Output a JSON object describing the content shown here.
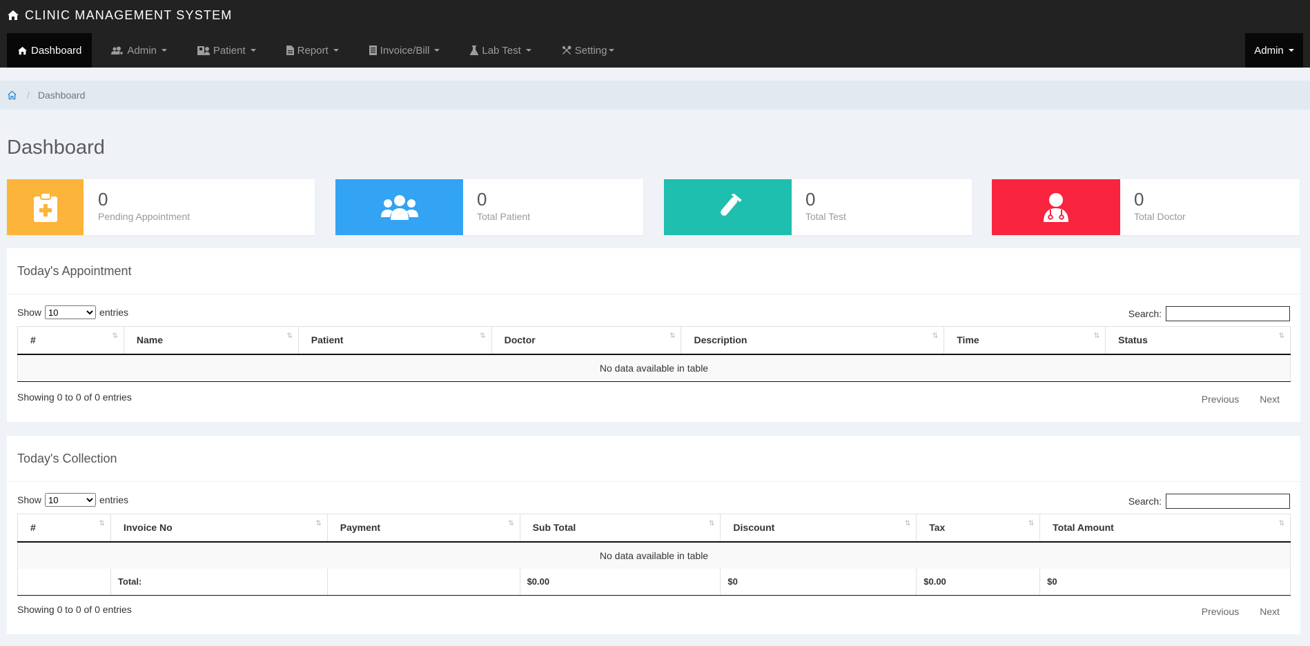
{
  "app": {
    "title": "CLINIC MANAGEMENT SYSTEM"
  },
  "nav": {
    "items": [
      {
        "label": "Dashboard",
        "icon": "home-icon"
      },
      {
        "label": "Admin",
        "icon": "users-cog-icon"
      },
      {
        "label": "Patient",
        "icon": "hospital-user-icon"
      },
      {
        "label": "Report",
        "icon": "file-icon"
      },
      {
        "label": "Invoice/Bill",
        "icon": "invoice-icon"
      },
      {
        "label": "Lab Test",
        "icon": "flask-icon"
      },
      {
        "label": "Setting",
        "icon": "tools-icon"
      }
    ],
    "user_menu": "Admin"
  },
  "breadcrumb": {
    "current": "Dashboard"
  },
  "page": {
    "title": "Dashboard"
  },
  "cards": [
    {
      "value": "0",
      "label": "Pending Appointment",
      "color": "#fdb43a",
      "icon": "clipboard-medical-icon"
    },
    {
      "value": "0",
      "label": "Total Patient",
      "color": "#33a3f4",
      "icon": "users-icon"
    },
    {
      "value": "0",
      "label": "Total Test",
      "color": "#1ebfae",
      "icon": "syringe-icon"
    },
    {
      "value": "0",
      "label": "Total Doctor",
      "color": "#f9243f",
      "icon": "doctor-icon"
    }
  ],
  "appointments": {
    "title": "Today's Appointment",
    "show_label": "Show",
    "entries_label": "entries",
    "page_size": "10",
    "search_label": "Search:",
    "columns": [
      "#",
      "Name",
      "Patient",
      "Doctor",
      "Description",
      "Time",
      "Status"
    ],
    "empty_text": "No data available in table",
    "info": "Showing 0 to 0 of 0 entries",
    "prev": "Previous",
    "next": "Next"
  },
  "collection": {
    "title": "Today's Collection",
    "show_label": "Show",
    "entries_label": "entries",
    "page_size": "10",
    "search_label": "Search:",
    "columns": [
      "#",
      "Invoice No",
      "Payment",
      "Sub Total",
      "Discount",
      "Tax",
      "Total Amount"
    ],
    "empty_text": "No data available in table",
    "total_label": "Total:",
    "totals": {
      "sub_total": "$0.00",
      "discount": "$0",
      "tax": "$0.00",
      "total_amount": "$0"
    },
    "info": "Showing 0 to 0 of 0 entries",
    "prev": "Previous",
    "next": "Next"
  }
}
